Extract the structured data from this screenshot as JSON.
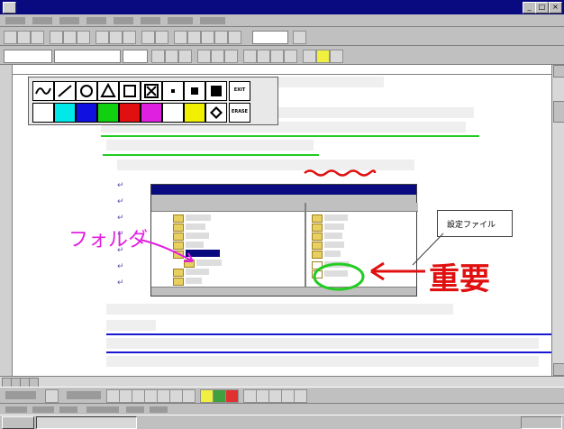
{
  "window": {
    "controls": [
      "_",
      "□",
      "×"
    ]
  },
  "palette": {
    "erase_label_1": "EXIT",
    "erase_label_2": "ERASE"
  },
  "document": {
    "colors": {
      "green_underline": "#22cc22",
      "blue_underline": "#1818d0",
      "red_ink": "#e01010",
      "magenta_ink": "#e020e0",
      "green_circle": "#22cc22"
    }
  },
  "explorer": {
    "title_bar": "#0a0a80"
  },
  "annotations": {
    "folder_label": "フォルダ",
    "important_label": "重要",
    "callout_label": "設定ファイル"
  }
}
